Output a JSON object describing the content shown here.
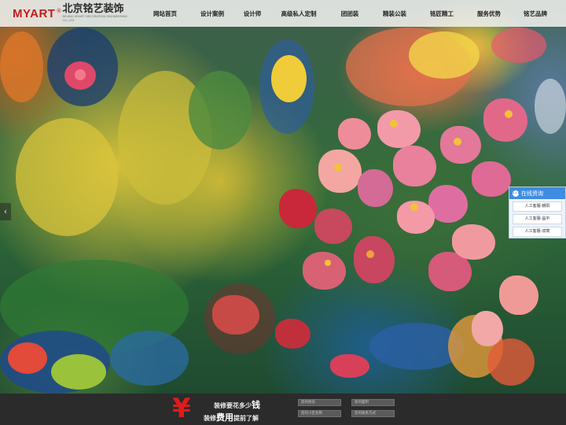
{
  "header": {
    "logo_latin": "MYART",
    "logo_mark": "®",
    "logo_cn": "北京铭艺装饰",
    "logo_en": "BEIJING MYART DECORATION ENGINEERING CO.,LTD"
  },
  "nav": {
    "items": [
      "网站首页",
      "设计案例",
      "设计师",
      "高级私人定制",
      "团团装",
      "精装公装",
      "铭匠精工",
      "服务优势",
      "铭艺品牌"
    ]
  },
  "slider": {
    "prev_glyph": "‹"
  },
  "consult": {
    "title": "在线资询",
    "rows": [
      "人工客服-朝阳",
      "人工客服-昌平",
      "人工客服-双窝"
    ]
  },
  "footer": {
    "yen": "¥",
    "slogan1_pre": "装修要花多少",
    "slogan1_big": "钱",
    "slogan2_pre": "装修",
    "slogan2_big": "费用",
    "slogan2_post": "提前了解",
    "fields": [
      "您的姓名",
      "您的面积",
      "您的小区名称",
      "您的联系方式"
    ]
  },
  "colors": {
    "brand_red": "#c01e1e",
    "consult_blue": "#3e8de3",
    "footer_bg": "#2b2b2b"
  }
}
